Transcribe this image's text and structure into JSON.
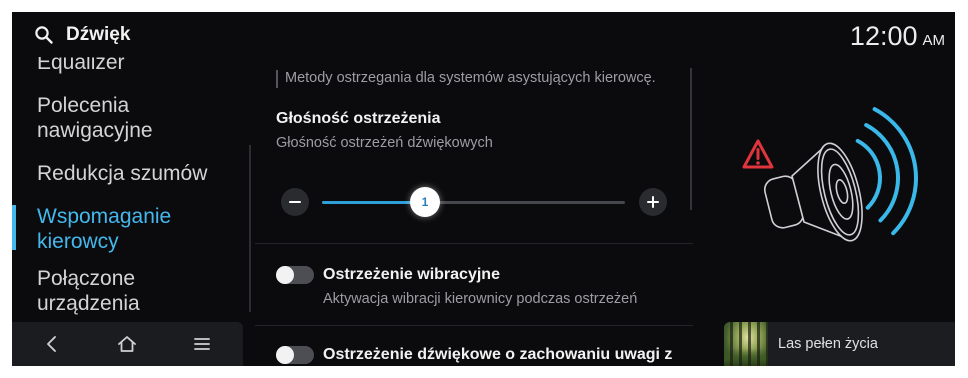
{
  "header": {
    "title": "Dźwięk",
    "search_icon": "search-icon",
    "time": "12:00",
    "meridiem": "AM"
  },
  "sidebar": {
    "items": [
      {
        "label": "Equalizer",
        "active": false
      },
      {
        "label": "Polecenia nawigacyjne",
        "active": false
      },
      {
        "label": "Redukcja szumów",
        "active": false
      },
      {
        "label": "Wspomaganie kierowcy",
        "active": true
      },
      {
        "label": "Połączone urządzenia",
        "active": false
      }
    ]
  },
  "navbar": {
    "icons": [
      "chevron-left-icon",
      "home-icon",
      "menu-icon"
    ]
  },
  "content": {
    "intro": "Metody ostrzegania dla systemów asystujących kierowcę.",
    "volume": {
      "title": "Głośność ostrzeżenia",
      "subtitle": "Głośność ostrzeżeń dźwiękowych",
      "value": "1",
      "level_fraction": 0.34,
      "decrease_icon": "minus-icon",
      "increase_icon": "plus-icon"
    },
    "options": [
      {
        "title": "Ostrzeżenie wibracyjne",
        "subtitle": "Aktywacja wibracji kierownicy podczas ostrzeżeń",
        "enabled": false
      },
      {
        "title": "Ostrzeżenie dźwiękowe o zachowaniu uwagi z",
        "enabled": false
      }
    ]
  },
  "illustration": {
    "icons": [
      "warning-icon",
      "speaker-icon",
      "sound-waves-icon"
    ]
  },
  "media": {
    "track": "Las pełen życia"
  },
  "colors": {
    "background": "#0b0b0d",
    "accent": "#44b8ec",
    "warning": "#e0353d",
    "text": "#e6e6e8",
    "muted": "#9d9da3"
  }
}
